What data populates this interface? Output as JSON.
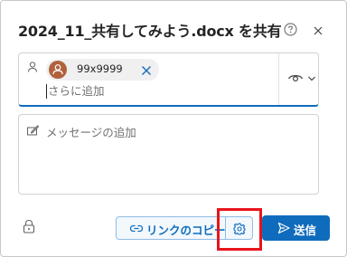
{
  "dialog": {
    "title": "2024_11_共有してみよう.docx を共有",
    "help_icon": "question-circle-icon",
    "close_icon": "close-icon"
  },
  "recipients": {
    "person_icon": "person-icon",
    "chips": [
      {
        "name": "99x9999",
        "avatar_color": "#b0623c",
        "remove_icon": "dismiss-icon"
      }
    ],
    "add_placeholder": "さらに追加",
    "permission_icon": "eye-icon",
    "permission_dropdown_icon": "chevron-down-icon"
  },
  "message": {
    "icon": "edit-icon",
    "placeholder": "メッセージの追加"
  },
  "footer": {
    "lock_icon": "lock-icon",
    "copy_link_label": "リンクのコピー",
    "copy_link_icon": "link-icon",
    "settings_icon": "gear-icon",
    "send_label": "送信",
    "send_icon": "send-icon"
  },
  "colors": {
    "accent": "#0f6cbd",
    "highlight": "#e8141b",
    "avatar": "#b0623c"
  }
}
